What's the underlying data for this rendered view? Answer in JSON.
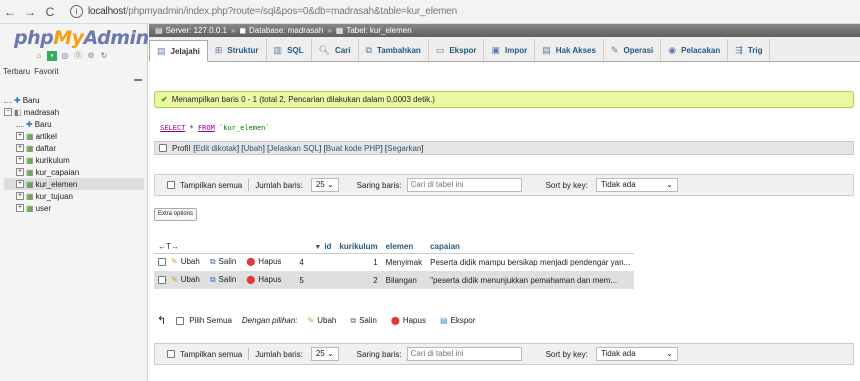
{
  "browser": {
    "back": "←",
    "forward": "→",
    "reload": "C",
    "info": "i",
    "url_host": "localhost",
    "url_rest": "/phpmyadmin/index.php?route=/sql&pos=0&db=madrasah&table=kur_elemen"
  },
  "logo": {
    "php": "php",
    "my": "My",
    "admin": "Admin"
  },
  "left_tabs": [
    "Terbaru",
    "Favorit"
  ],
  "tree": [
    {
      "label": "Baru",
      "indent": 0,
      "expander": "",
      "icon": "db-new"
    },
    {
      "label": "madrasah",
      "indent": 0,
      "expander": "−",
      "icon": "database"
    },
    {
      "label": "Baru",
      "indent": 1,
      "expander": "",
      "icon": "table-new"
    },
    {
      "label": "artikel",
      "indent": 1,
      "expander": "+",
      "icon": "table"
    },
    {
      "label": "daftar",
      "indent": 1,
      "expander": "+",
      "icon": "table"
    },
    {
      "label": "kurikulum",
      "indent": 1,
      "expander": "+",
      "icon": "table"
    },
    {
      "label": "kur_capaian",
      "indent": 1,
      "expander": "+",
      "icon": "table"
    },
    {
      "label": "kur_elemen",
      "indent": 1,
      "expander": "+",
      "icon": "table",
      "selected": true
    },
    {
      "label": "kur_tujuan",
      "indent": 1,
      "expander": "+",
      "icon": "table"
    },
    {
      "label": "user",
      "indent": 1,
      "expander": "+",
      "icon": "table"
    }
  ],
  "breadcrumb": {
    "server": "Server: 127.0.0.1",
    "database": "Database: madrasah",
    "table": "Tabel: kur_elemen",
    "sep": "»"
  },
  "tabs": [
    {
      "label": "Jelajahi",
      "icon": "browse-icon",
      "active": true
    },
    {
      "label": "Struktur",
      "icon": "structure-icon"
    },
    {
      "label": "SQL",
      "icon": "sql-icon"
    },
    {
      "label": "Cari",
      "icon": "search-icon"
    },
    {
      "label": "Tambahkan",
      "icon": "insert-icon"
    },
    {
      "label": "Ekspor",
      "icon": "export-icon"
    },
    {
      "label": "Impor",
      "icon": "import-icon"
    },
    {
      "label": "Hak Akses",
      "icon": "privileges-icon"
    },
    {
      "label": "Operasi",
      "icon": "operations-icon"
    },
    {
      "label": "Pelacakan",
      "icon": "tracking-icon"
    },
    {
      "label": "Trig",
      "icon": "triggers-icon"
    }
  ],
  "message": {
    "check": "✔",
    "text": "Menampilkan baris 0 - 1 (total 2, Pencarian dilakukan dalam 0,0003 detik.)"
  },
  "query": {
    "kw1": "SELECT",
    "rest": " * ",
    "kw2": "FROM",
    "table": " `kur_elemen`"
  },
  "profil": {
    "label": "Profil",
    "links": [
      "Edit dikotak",
      "Ubah",
      "Jelaskan SQL",
      "Buat kode PHP",
      "Segarkan"
    ]
  },
  "controls": {
    "show_all": "Tampilkan semua",
    "rows_label": "Jumlah baris:",
    "rows_value": "25",
    "filter_label": "Saring baris:",
    "filter_placeholder": "Cari di tabel ini",
    "sort_label": "Sort by key:",
    "sort_value": "Tidak ada"
  },
  "extra_options": "Extra options",
  "table": {
    "columns": [
      "id",
      "kurikulum",
      "elemen",
      "capaian"
    ],
    "sort_arrow": "▼",
    "nav_arrows": "←T→",
    "actions": {
      "edit": "Ubah",
      "copy": "Salin",
      "delete": "Hapus"
    },
    "rows": [
      {
        "id": "4",
        "kurikulum": "1",
        "elemen": "Menyimak",
        "capaian": "Peserta didik mampu bersikap menjadi pendengar yan..."
      },
      {
        "id": "5",
        "kurikulum": "2",
        "elemen": "Bilangan",
        "capaian": "\"peserta didik menunjukkan pemahaman dan mem..."
      }
    ]
  },
  "bulk": {
    "check_all": "Pilih Semua",
    "with_selected": "Dengan pilihan:",
    "edit": "Ubah",
    "copy": "Salin",
    "delete": "Hapus",
    "export": "Ekspor"
  }
}
